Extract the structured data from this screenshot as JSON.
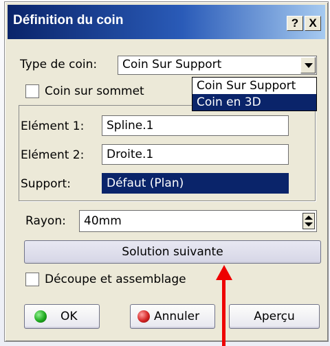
{
  "dialog": {
    "title": "Définition du coin",
    "help_button": "?",
    "close_button": "X"
  },
  "type_de_coin": {
    "label": "Type de coin:",
    "selected": "Coin Sur Support",
    "options": [
      "Coin Sur Support",
      "Coin en 3D"
    ],
    "highlighted_option": "Coin en 3D"
  },
  "coin_sur_sommet": {
    "label": "Coin sur sommet",
    "checked": false
  },
  "elements": {
    "element1_label": "Elément 1:",
    "element1_value": "Spline.1",
    "element2_label": "Elément 2:",
    "element2_value": "Droite.1",
    "support_label": "Support:",
    "support_value": "Défaut (Plan)"
  },
  "rayon": {
    "label": "Rayon:",
    "value": "40mm"
  },
  "solution_button": "Solution suivante",
  "decoupe": {
    "label": "Découpe et assemblage",
    "checked": false
  },
  "buttons": {
    "ok": "OK",
    "annuler": "Annuler",
    "apercu": "Aperçu"
  },
  "colors": {
    "title_start": "#0a246a",
    "title_end": "#a6caf0",
    "selection": "#0a246a",
    "annotation_arrow": "#ee0000",
    "ok_dot": "#1faa1f",
    "cancel_dot": "#d42424"
  }
}
